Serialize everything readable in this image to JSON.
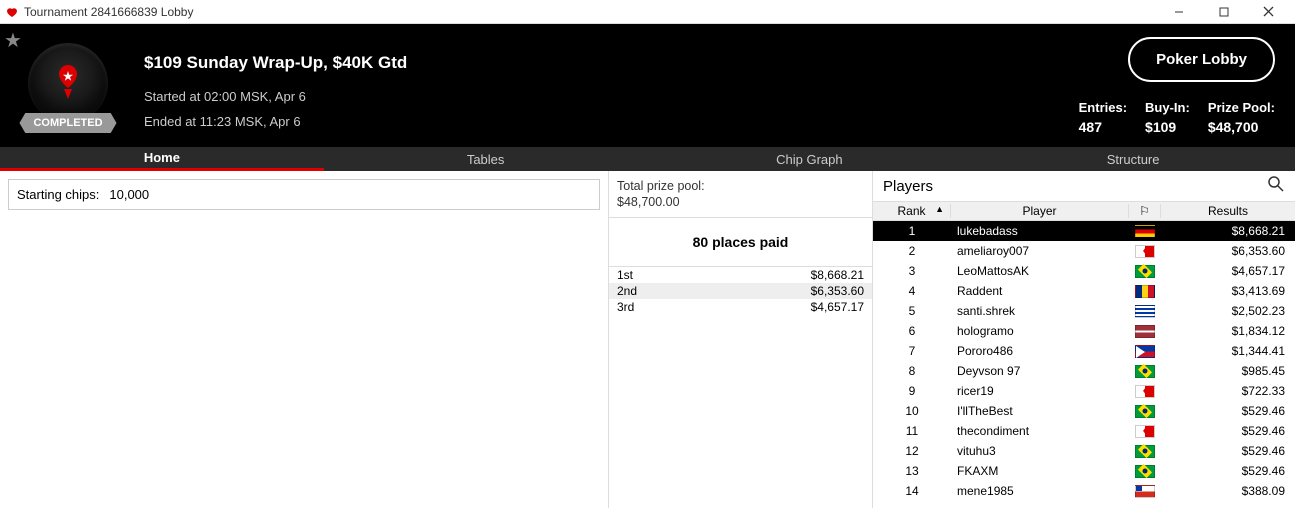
{
  "window": {
    "title": "Tournament 2841666839 Lobby"
  },
  "header": {
    "status": "COMPLETED",
    "tournament_title": "$109 Sunday Wrap-Up, $40K Gtd",
    "started": "Started at 02:00 MSK, Apr 6",
    "ended": "Ended at 11:23 MSK, Apr 6",
    "lobby_button": "Poker Lobby",
    "stats": {
      "entries_label": "Entries:",
      "entries_value": "487",
      "buyin_label": "Buy-In:",
      "buyin_value": "$109",
      "prizepool_label": "Prize Pool:",
      "prizepool_value": "$48,700"
    }
  },
  "tabs": {
    "home": "Home",
    "tables": "Tables",
    "chipgraph": "Chip Graph",
    "structure": "Structure"
  },
  "left": {
    "starting_chips_label": "Starting chips:",
    "starting_chips_value": "10,000"
  },
  "middle": {
    "total_prize_label": "Total prize pool:",
    "total_prize_value": "$48,700.00",
    "places_paid": "80 places paid",
    "payouts": [
      {
        "place": "1st",
        "amount": "$8,668.21"
      },
      {
        "place": "2nd",
        "amount": "$6,353.60"
      },
      {
        "place": "3rd",
        "amount": "$4,657.17"
      }
    ]
  },
  "players": {
    "title": "Players",
    "columns": {
      "rank": "Rank",
      "player": "Player",
      "flag": "⚐",
      "results": "Results"
    },
    "rows": [
      {
        "rank": "1",
        "player": "lukebadass",
        "flag": "DE",
        "result": "$8,668.21",
        "selected": true
      },
      {
        "rank": "2",
        "player": "ameliaroy007",
        "flag": "CA",
        "result": "$6,353.60"
      },
      {
        "rank": "3",
        "player": "LeoMattosAK",
        "flag": "BR",
        "result": "$4,657.17"
      },
      {
        "rank": "4",
        "player": "Raddent",
        "flag": "RO",
        "result": "$3,413.69"
      },
      {
        "rank": "5",
        "player": "santi.shrek",
        "flag": "UY",
        "result": "$2,502.23"
      },
      {
        "rank": "6",
        "player": "hologramo",
        "flag": "LV",
        "result": "$1,834.12"
      },
      {
        "rank": "7",
        "player": "Pororo486",
        "flag": "PH",
        "result": "$1,344.41"
      },
      {
        "rank": "8",
        "player": "Deyvson 97",
        "flag": "BR",
        "result": "$985.45"
      },
      {
        "rank": "9",
        "player": "ricer19",
        "flag": "CA",
        "result": "$722.33"
      },
      {
        "rank": "10",
        "player": "I'llTheBest",
        "flag": "BR",
        "result": "$529.46"
      },
      {
        "rank": "11",
        "player": "thecondiment",
        "flag": "CA",
        "result": "$529.46"
      },
      {
        "rank": "12",
        "player": "vituhu3",
        "flag": "BR",
        "result": "$529.46"
      },
      {
        "rank": "13",
        "player": "FKAXM",
        "flag": "BR",
        "result": "$529.46"
      },
      {
        "rank": "14",
        "player": "mene1985",
        "flag": "CL",
        "result": "$388.09"
      }
    ]
  }
}
